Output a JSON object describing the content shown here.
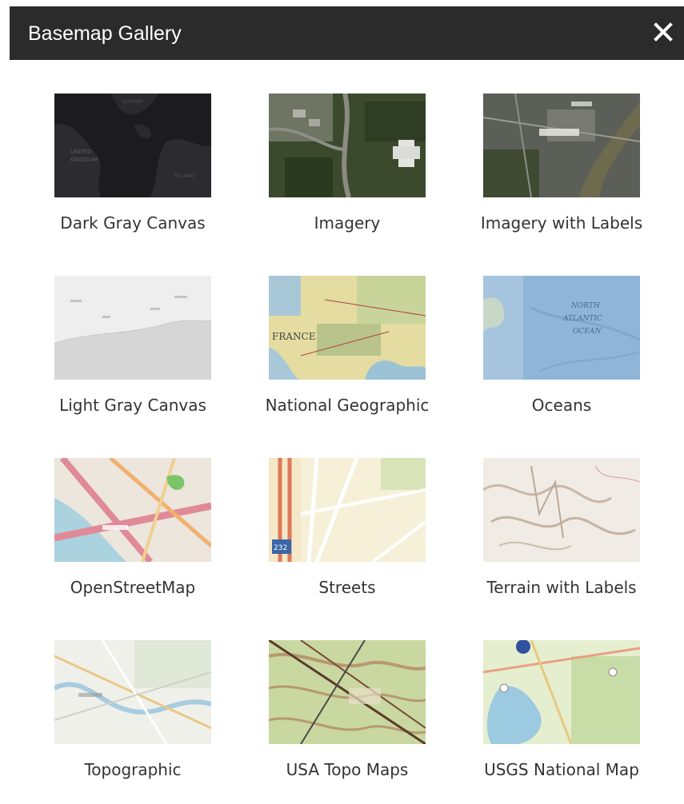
{
  "header": {
    "title": "Basemap Gallery",
    "close_icon": "close-icon"
  },
  "basemaps": [
    {
      "label": "Dark Gray Canvas"
    },
    {
      "label": "Imagery"
    },
    {
      "label": "Imagery with Labels"
    },
    {
      "label": "Light Gray Canvas"
    },
    {
      "label": "National Geographic"
    },
    {
      "label": "Oceans"
    },
    {
      "label": "OpenStreetMap"
    },
    {
      "label": "Streets"
    },
    {
      "label": "Terrain with Labels"
    },
    {
      "label": "Topographic"
    },
    {
      "label": "USA Topo Maps"
    },
    {
      "label": "USGS National Map"
    }
  ],
  "thumb_text": {
    "oceans_north": "NORTH",
    "oceans_atlantic": "ATLANTIC",
    "oceans_ocean": "OCEAN",
    "natgeo_france": "FRANCE",
    "streets_shield": "232"
  },
  "colors": {
    "header_bg": "#2b2b2b",
    "header_text": "#ffffff",
    "label_text": "#333333"
  }
}
